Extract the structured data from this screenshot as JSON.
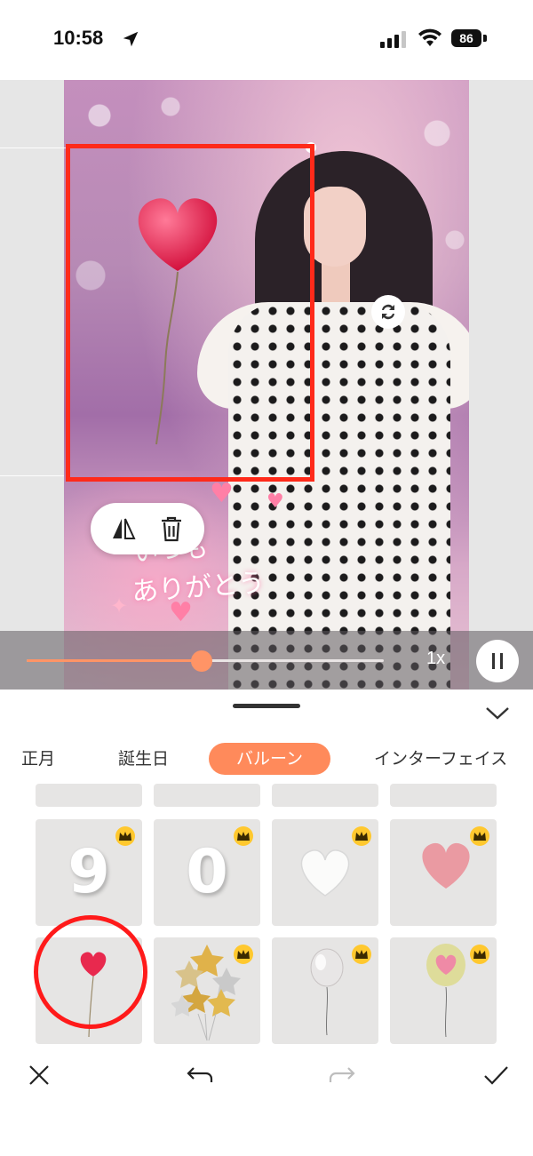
{
  "status_bar": {
    "time": "10:58",
    "battery": "86",
    "icons": [
      "location-arrow-icon",
      "signal-icon",
      "wifi-icon",
      "battery-icon"
    ]
  },
  "editor": {
    "overlay_text_line1": "いつも",
    "overlay_text_line2": "ありがとう",
    "toolbar_icons": [
      "flip-icon",
      "trash-icon"
    ],
    "rotate_icon": "rotate-icon",
    "selection_color": "#ff2a1a"
  },
  "playback": {
    "progress": 0.49,
    "speed": "1x",
    "accent": "#ff9466",
    "pause_icon": "pause-icon"
  },
  "panel": {
    "collapse_icon": "chevron-down-icon",
    "tabs": [
      {
        "label": "正月",
        "active": false
      },
      {
        "label": "誕生日",
        "active": false
      },
      {
        "label": "バルーン",
        "active": true
      },
      {
        "label": "インターフェイス",
        "active": false
      }
    ],
    "active_tab_color": "#ff8a5b",
    "stickers": [
      {
        "name": "number-9-balloon",
        "premium": true,
        "label": "9"
      },
      {
        "name": "number-0-balloon",
        "premium": true,
        "label": "0"
      },
      {
        "name": "white-heart-balloon",
        "premium": true
      },
      {
        "name": "pink-heart-balloon",
        "premium": true
      },
      {
        "name": "red-heart-stick-balloon",
        "premium": false,
        "selected": true
      },
      {
        "name": "gold-silver-stars-balloons",
        "premium": true
      },
      {
        "name": "silver-balloon",
        "premium": true
      },
      {
        "name": "green-pink-balloon",
        "premium": true
      }
    ]
  },
  "bottom_actions": [
    "close-icon",
    "undo-icon",
    "redo-icon",
    "check-icon"
  ]
}
